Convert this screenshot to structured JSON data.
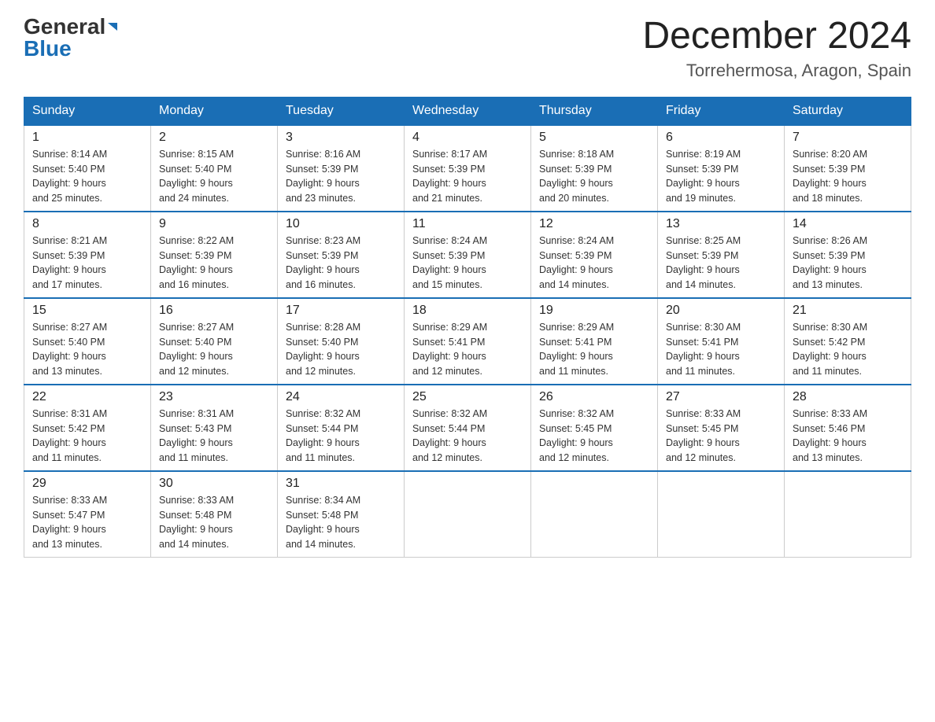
{
  "header": {
    "logo": {
      "general": "General",
      "blue": "Blue",
      "arrow": "▶"
    },
    "title": "December 2024",
    "subtitle": "Torrehermosa, Aragon, Spain"
  },
  "weekdays": [
    "Sunday",
    "Monday",
    "Tuesday",
    "Wednesday",
    "Thursday",
    "Friday",
    "Saturday"
  ],
  "weeks": [
    [
      {
        "day": "1",
        "sunrise": "8:14 AM",
        "sunset": "5:40 PM",
        "daylight": "9 hours and 25 minutes."
      },
      {
        "day": "2",
        "sunrise": "8:15 AM",
        "sunset": "5:40 PM",
        "daylight": "9 hours and 24 minutes."
      },
      {
        "day": "3",
        "sunrise": "8:16 AM",
        "sunset": "5:39 PM",
        "daylight": "9 hours and 23 minutes."
      },
      {
        "day": "4",
        "sunrise": "8:17 AM",
        "sunset": "5:39 PM",
        "daylight": "9 hours and 21 minutes."
      },
      {
        "day": "5",
        "sunrise": "8:18 AM",
        "sunset": "5:39 PM",
        "daylight": "9 hours and 20 minutes."
      },
      {
        "day": "6",
        "sunrise": "8:19 AM",
        "sunset": "5:39 PM",
        "daylight": "9 hours and 19 minutes."
      },
      {
        "day": "7",
        "sunrise": "8:20 AM",
        "sunset": "5:39 PM",
        "daylight": "9 hours and 18 minutes."
      }
    ],
    [
      {
        "day": "8",
        "sunrise": "8:21 AM",
        "sunset": "5:39 PM",
        "daylight": "9 hours and 17 minutes."
      },
      {
        "day": "9",
        "sunrise": "8:22 AM",
        "sunset": "5:39 PM",
        "daylight": "9 hours and 16 minutes."
      },
      {
        "day": "10",
        "sunrise": "8:23 AM",
        "sunset": "5:39 PM",
        "daylight": "9 hours and 16 minutes."
      },
      {
        "day": "11",
        "sunrise": "8:24 AM",
        "sunset": "5:39 PM",
        "daylight": "9 hours and 15 minutes."
      },
      {
        "day": "12",
        "sunrise": "8:24 AM",
        "sunset": "5:39 PM",
        "daylight": "9 hours and 14 minutes."
      },
      {
        "day": "13",
        "sunrise": "8:25 AM",
        "sunset": "5:39 PM",
        "daylight": "9 hours and 14 minutes."
      },
      {
        "day": "14",
        "sunrise": "8:26 AM",
        "sunset": "5:39 PM",
        "daylight": "9 hours and 13 minutes."
      }
    ],
    [
      {
        "day": "15",
        "sunrise": "8:27 AM",
        "sunset": "5:40 PM",
        "daylight": "9 hours and 13 minutes."
      },
      {
        "day": "16",
        "sunrise": "8:27 AM",
        "sunset": "5:40 PM",
        "daylight": "9 hours and 12 minutes."
      },
      {
        "day": "17",
        "sunrise": "8:28 AM",
        "sunset": "5:40 PM",
        "daylight": "9 hours and 12 minutes."
      },
      {
        "day": "18",
        "sunrise": "8:29 AM",
        "sunset": "5:41 PM",
        "daylight": "9 hours and 12 minutes."
      },
      {
        "day": "19",
        "sunrise": "8:29 AM",
        "sunset": "5:41 PM",
        "daylight": "9 hours and 11 minutes."
      },
      {
        "day": "20",
        "sunrise": "8:30 AM",
        "sunset": "5:41 PM",
        "daylight": "9 hours and 11 minutes."
      },
      {
        "day": "21",
        "sunrise": "8:30 AM",
        "sunset": "5:42 PM",
        "daylight": "9 hours and 11 minutes."
      }
    ],
    [
      {
        "day": "22",
        "sunrise": "8:31 AM",
        "sunset": "5:42 PM",
        "daylight": "9 hours and 11 minutes."
      },
      {
        "day": "23",
        "sunrise": "8:31 AM",
        "sunset": "5:43 PM",
        "daylight": "9 hours and 11 minutes."
      },
      {
        "day": "24",
        "sunrise": "8:32 AM",
        "sunset": "5:44 PM",
        "daylight": "9 hours and 11 minutes."
      },
      {
        "day": "25",
        "sunrise": "8:32 AM",
        "sunset": "5:44 PM",
        "daylight": "9 hours and 12 minutes."
      },
      {
        "day": "26",
        "sunrise": "8:32 AM",
        "sunset": "5:45 PM",
        "daylight": "9 hours and 12 minutes."
      },
      {
        "day": "27",
        "sunrise": "8:33 AM",
        "sunset": "5:45 PM",
        "daylight": "9 hours and 12 minutes."
      },
      {
        "day": "28",
        "sunrise": "8:33 AM",
        "sunset": "5:46 PM",
        "daylight": "9 hours and 13 minutes."
      }
    ],
    [
      {
        "day": "29",
        "sunrise": "8:33 AM",
        "sunset": "5:47 PM",
        "daylight": "9 hours and 13 minutes."
      },
      {
        "day": "30",
        "sunrise": "8:33 AM",
        "sunset": "5:48 PM",
        "daylight": "9 hours and 14 minutes."
      },
      {
        "day": "31",
        "sunrise": "8:34 AM",
        "sunset": "5:48 PM",
        "daylight": "9 hours and 14 minutes."
      },
      null,
      null,
      null,
      null
    ]
  ],
  "labels": {
    "sunrise": "Sunrise:",
    "sunset": "Sunset:",
    "daylight": "Daylight: 9 hours"
  }
}
